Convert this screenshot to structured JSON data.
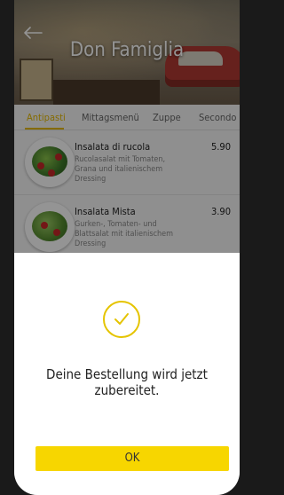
{
  "header": {
    "title": "Don Famiglia",
    "back_icon": "back-arrow-icon"
  },
  "tabs": [
    {
      "label": "Antipasti",
      "active": true
    },
    {
      "label": "Mittagsmenü",
      "active": false
    },
    {
      "label": "Zuppe",
      "active": false
    },
    {
      "label": "Secondo",
      "active": false
    }
  ],
  "menu": [
    {
      "name": "Insalata di rucola",
      "price": "5.90",
      "description": "Rucolasalat mit Tomaten, Grana und italienischem Dressing"
    },
    {
      "name": "Insalata Mista",
      "price": "3.90",
      "description": "Gurken-, Tomaten- und Blattsalat mit italienischem Dressing"
    }
  ],
  "modal": {
    "icon": "checkmark-icon",
    "message_line1": "Deine Bestellung wird jetzt",
    "message_line2": "zubereitet.",
    "ok_label": "OK"
  },
  "colors": {
    "accent": "#f7d600",
    "tab_active": "#e5b800"
  }
}
